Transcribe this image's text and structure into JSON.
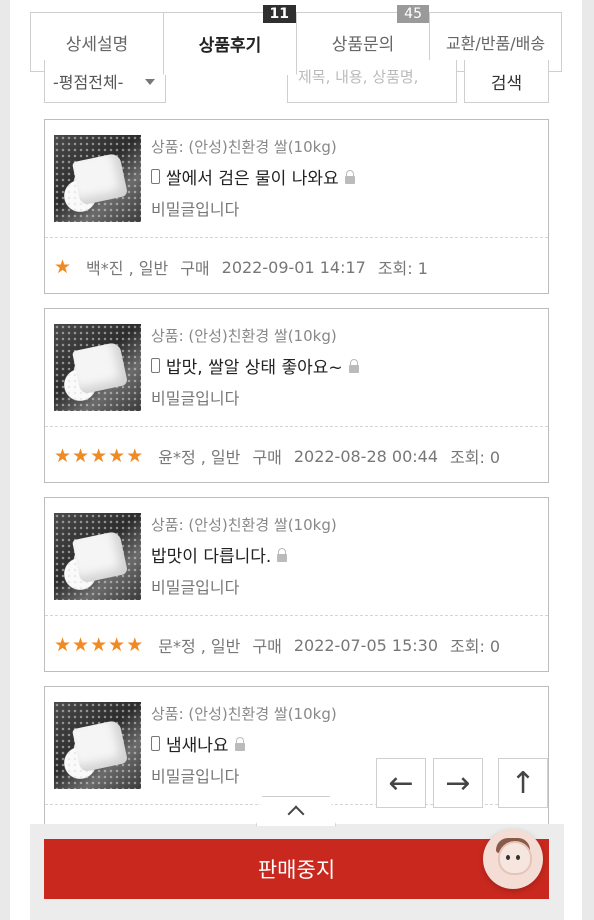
{
  "tabs": [
    {
      "label": "상세설명",
      "count": null
    },
    {
      "label": "상품후기",
      "count": "11"
    },
    {
      "label": "상품문의",
      "count": "45"
    },
    {
      "label": "교환/반품/배송",
      "count": null
    }
  ],
  "filter": {
    "rating_select": "-평점전체-",
    "search_placeholder": "제목, 내용, 상품명,",
    "search_button": "검색"
  },
  "reviews": [
    {
      "product": "상품: (안성)친환경 쌀(10kg)",
      "title": "쌀에서 검은 물이 나와요",
      "mobile": true,
      "secret": "비밀글입니다",
      "stars": 1,
      "author": "백*진 , 일반",
      "type": "구매",
      "date": "2022-09-01 14:17",
      "views": "조회: 1"
    },
    {
      "product": "상품: (안성)친환경 쌀(10kg)",
      "title": "밥맛, 쌀알 상태 좋아요~",
      "mobile": true,
      "secret": "비밀글입니다",
      "stars": 5,
      "author": "윤*정 , 일반",
      "type": "구매",
      "date": "2022-08-28 00:44",
      "views": "조회: 0"
    },
    {
      "product": "상품: (안성)친환경 쌀(10kg)",
      "title": "밥맛이 다릅니다.",
      "mobile": false,
      "secret": "비밀글입니다",
      "stars": 5,
      "author": "문*정 , 일반",
      "type": "구매",
      "date": "2022-07-05 15:30",
      "views": "조회: 0"
    },
    {
      "product": "상품: (안성)친환경 쌀(10kg)",
      "title": "냄새나요",
      "mobile": true,
      "secret": "비밀글입니다",
      "stars": 0,
      "author": "",
      "type": "",
      "date": "",
      "views": ""
    }
  ],
  "bottom": {
    "sale_button": "판매중지"
  },
  "colors": {
    "accent_red": "#c9281e",
    "star_orange": "#f08a24"
  }
}
